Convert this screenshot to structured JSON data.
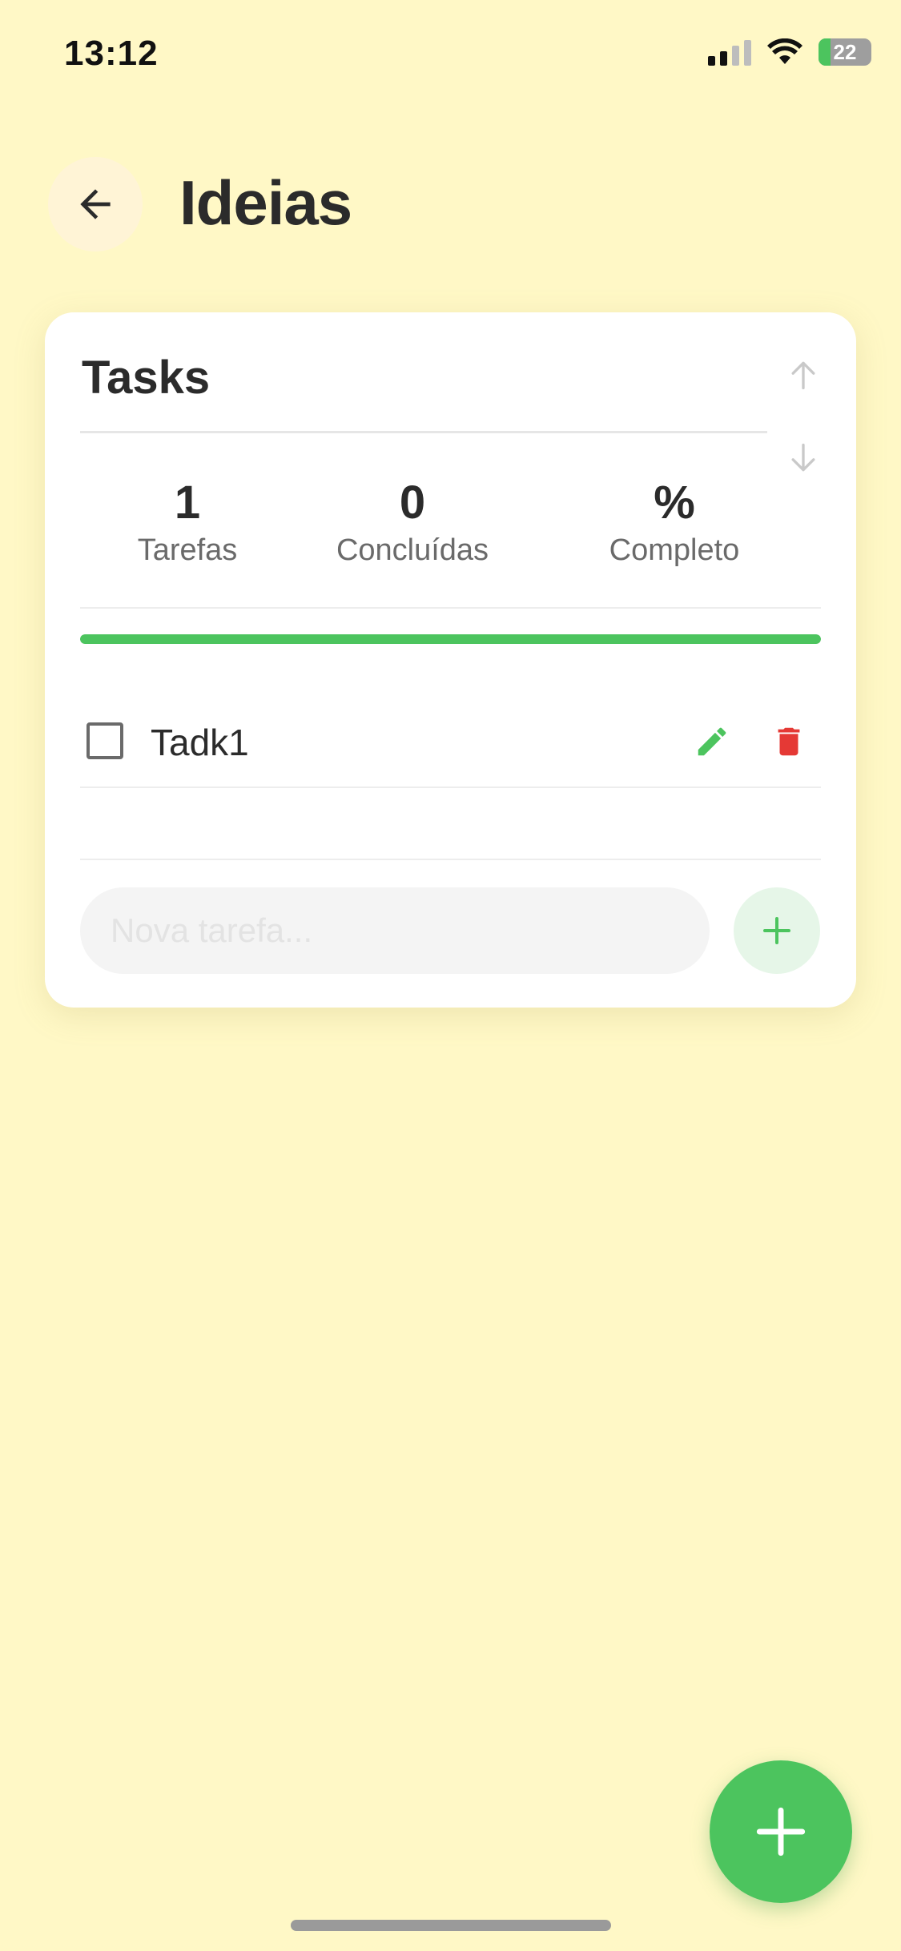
{
  "status_bar": {
    "time": "13:12",
    "battery_level": "22",
    "battery_charge_fraction": 0.22,
    "battery_charging": true,
    "signal_bars_active": 2,
    "signal_bars_total": 4
  },
  "header": {
    "title": "Ideias",
    "back_icon": "arrow-left-icon"
  },
  "card": {
    "title": "Tasks",
    "move_up_icon": "arrow-up-icon",
    "move_down_icon": "arrow-down-icon",
    "stats": [
      {
        "value": "1",
        "label": "Tarefas"
      },
      {
        "value": "0",
        "label": "Concluídas"
      },
      {
        "value": "%",
        "label": "Completo"
      }
    ],
    "progress_fraction": 1.0,
    "tasks": [
      {
        "label": "Tadk1",
        "checked": false,
        "edit_icon": "pencil-icon",
        "delete_icon": "trash-icon"
      }
    ],
    "new_task": {
      "placeholder": "Nova tarefa...",
      "value": "",
      "add_icon": "plus-icon"
    }
  },
  "fab": {
    "icon": "plus-icon"
  },
  "colors": {
    "background": "#FFF8C6",
    "accent_green": "#4CC45E",
    "danger_red": "#E53935",
    "text_dark": "#2B2B2B",
    "text_muted": "#6A6A6A"
  }
}
